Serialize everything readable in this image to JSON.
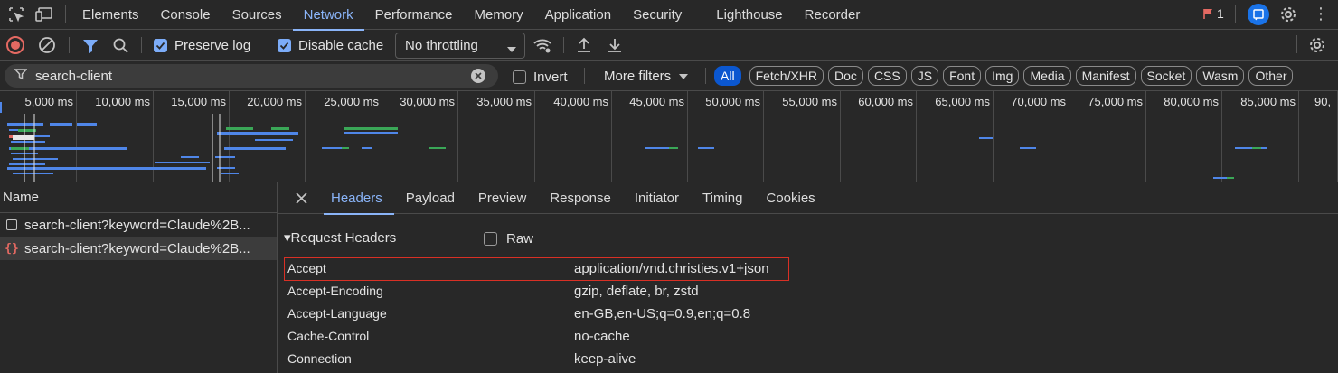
{
  "tabbar": {
    "tabs": [
      {
        "label": "Elements",
        "active": false
      },
      {
        "label": "Console",
        "active": false
      },
      {
        "label": "Sources",
        "active": false
      },
      {
        "label": "Network",
        "active": true
      },
      {
        "label": "Performance",
        "active": false
      },
      {
        "label": "Memory",
        "active": false
      },
      {
        "label": "Application",
        "active": false
      },
      {
        "label": "Security",
        "active": false
      },
      {
        "label": "Lighthouse",
        "active": false
      },
      {
        "label": "Recorder",
        "active": false
      }
    ],
    "issues_count": "1"
  },
  "toolbar": {
    "preserve_log_label": "Preserve log",
    "preserve_log_checked": true,
    "disable_cache_label": "Disable cache",
    "disable_cache_checked": true,
    "throttling_value": "No throttling"
  },
  "filterbar": {
    "filter_value": "search-client",
    "invert_label": "Invert",
    "more_filters_label": "More filters",
    "type_pills": [
      {
        "label": "All",
        "active": true
      },
      {
        "label": "Fetch/XHR",
        "active": false
      },
      {
        "label": "Doc",
        "active": false
      },
      {
        "label": "CSS",
        "active": false
      },
      {
        "label": "JS",
        "active": false
      },
      {
        "label": "Font",
        "active": false
      },
      {
        "label": "Img",
        "active": false
      },
      {
        "label": "Media",
        "active": false
      },
      {
        "label": "Manifest",
        "active": false
      },
      {
        "label": "Socket",
        "active": false
      },
      {
        "label": "Wasm",
        "active": false
      },
      {
        "label": "Other",
        "active": false
      }
    ]
  },
  "timeline": {
    "ticks": [
      "5,000 ms",
      "10,000 ms",
      "15,000 ms",
      "20,000 ms",
      "25,000 ms",
      "30,000 ms",
      "35,000 ms",
      "40,000 ms",
      "45,000 ms",
      "50,000 ms",
      "55,000 ms",
      "60,000 ms",
      "65,000 ms",
      "70,000 ms",
      "75,000 ms",
      "80,000 ms",
      "85,000 ms",
      "90,"
    ]
  },
  "requests": {
    "header": "Name",
    "rows": [
      {
        "name": "search-client?keyword=Claude%2B...",
        "selected": false
      },
      {
        "name": "search-client?keyword=Claude%2B...",
        "selected": true
      }
    ]
  },
  "details": {
    "tabs": [
      {
        "label": "Headers",
        "active": true
      },
      {
        "label": "Payload",
        "active": false
      },
      {
        "label": "Preview",
        "active": false
      },
      {
        "label": "Response",
        "active": false
      },
      {
        "label": "Initiator",
        "active": false
      },
      {
        "label": "Timing",
        "active": false
      },
      {
        "label": "Cookies",
        "active": false
      }
    ],
    "section_title": "▾Request Headers",
    "raw_label": "Raw",
    "headers": [
      {
        "name": "Accept",
        "value": "application/vnd.christies.v1+json",
        "highlighted": true
      },
      {
        "name": "Accept-Encoding",
        "value": "gzip, deflate, br, zstd",
        "highlighted": false
      },
      {
        "name": "Accept-Language",
        "value": "en-GB,en-US;q=0.9,en;q=0.8",
        "highlighted": false
      },
      {
        "name": "Cache-Control",
        "value": "no-cache",
        "highlighted": false
      },
      {
        "name": "Connection",
        "value": "keep-alive",
        "highlighted": false
      }
    ]
  },
  "colors": {
    "accent": "#8ab4f8",
    "record": "#e46962",
    "highlight_box": "#d93025",
    "bar_blue": "#4f86e8",
    "bar_green": "#3aa757"
  }
}
